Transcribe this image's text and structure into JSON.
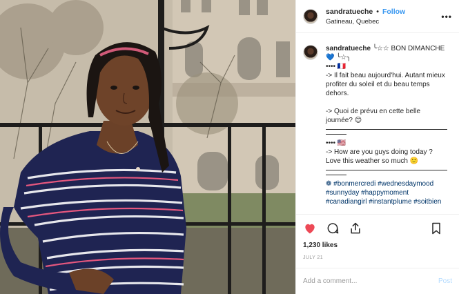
{
  "post": {
    "username": "sandratueche",
    "follow_label": "Follow",
    "location": "Gatineau, Quebec",
    "more_label": "•••",
    "caption_lines": [
      "╰☆☆ BON DIMANCHE",
      "💙 ╰☆╮",
      "•••• 🇫🇷",
      "-> Il fait beau aujourd'hui. Autant mieux profiter du soleil et du beau temps dehors.",
      "",
      "-> Quoi de prévu en cette belle journée? 😊",
      "•••• 🇺🇸",
      "-> How are you guys doing today ? Love this weather so much 🙂",
      "❁ #bonmercredi #wednesdaymood #sunnyday #happymoment #canadiangirl #instantplume #soitbien"
    ],
    "likes": "1,230 likes",
    "date": "JULY 21",
    "comment_placeholder": "Add a comment...",
    "post_label": "Post"
  },
  "colors": {
    "accent": "#3897f0",
    "like_heart": "#ed4956",
    "post_disabled": "#b3dbff"
  },
  "icons": {
    "like": "heart-icon",
    "comment": "comment-bubble-icon",
    "share": "share-icon",
    "save": "bookmark-icon"
  }
}
